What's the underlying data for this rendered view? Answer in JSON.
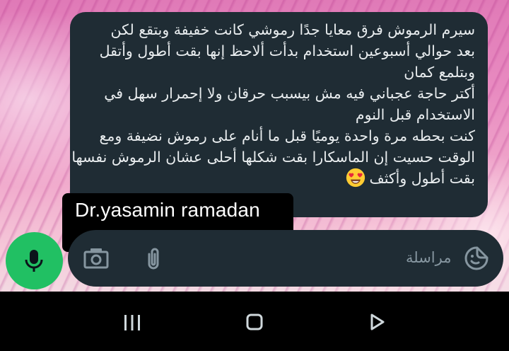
{
  "message": {
    "lines": [
      "سيرم الرموش فرق معايا جدًا رموشي كانت خفيفة وبتقع لكن",
      "بعد حوالي أسبوعين استخدام بدأت ألاحظ إنها بقت أطول وأتقل",
      "وبتلمع كمان",
      "أكتر حاجة عجباني فيه مش بيسبب حرقان ولا إحمرار سهل في",
      "الاستخدام قبل النوم",
      "كنت بحطه مرة واحدة يوميًا قبل ما أنام على رموش نضيفة ومع",
      "الوقت حسيت إن الماسكارا بقت شكلها أحلى عشان الرموش نفسها",
      "بقت أطول وأكثف"
    ],
    "emoji": "heart-eyes-emoji"
  },
  "watermark": {
    "text": "Dr.yasamin ramadan"
  },
  "composer": {
    "placeholder": "مراسلة",
    "icons": {
      "sticker": "sticker-icon",
      "attach": "paperclip-icon",
      "camera": "camera-icon",
      "mic": "microphone-icon"
    }
  },
  "navbar": {
    "icons": [
      "recents-icon",
      "home-icon",
      "back-icon"
    ]
  },
  "colors": {
    "bubble": "#1f2c34",
    "text": "#e9edef",
    "placeholder": "#8696a0",
    "mic_button": "#21c063",
    "wallpaper": "#e88ac0"
  }
}
